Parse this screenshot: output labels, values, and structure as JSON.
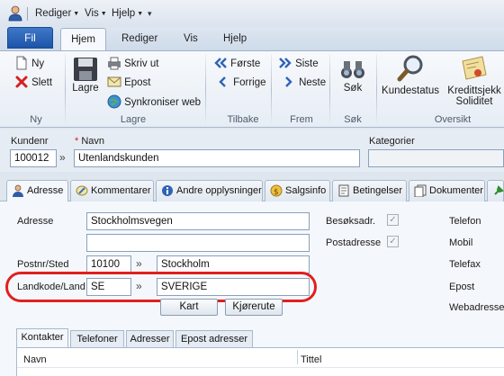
{
  "qab": {
    "menu1": "Rediger",
    "menu2": "Vis",
    "menu3": "Hjelp"
  },
  "tabs": {
    "file": "Fil",
    "home": "Hjem",
    "edit": "Rediger",
    "view": "Vis",
    "help": "Hjelp"
  },
  "ribbon": {
    "groups": {
      "ny": "Ny",
      "lagre": "Lagre",
      "tilbake": "Tilbake",
      "frem": "Frem",
      "sok": "Søk",
      "oversikt": "Oversikt"
    },
    "ny_label": "Ny",
    "slett_label": "Slett",
    "lagre_label": "Lagre",
    "skriv_ut_label": "Skriv ut",
    "epost_label": "Epost",
    "synk_label": "Synkroniser web",
    "forste_label": "Første",
    "forrige_label": "Forrige",
    "siste_label": "Siste",
    "neste_label": "Neste",
    "sok_label": "Søk",
    "kundestatus_label": "Kundestatus",
    "kredittsjekk_label1": "Kredittsjekk",
    "kredittsjekk_label2": "Soliditet"
  },
  "customer": {
    "kundenr_label": "Kundenr",
    "kundenr_value": "100012",
    "navn_required": "*",
    "navn_label": "Navn",
    "navn_value": "Utenlandskunden",
    "kategorier_label": "Kategorier"
  },
  "inner_tabs": {
    "adresse": "Adresse",
    "kommentarer": "Kommentarer",
    "andre": "Andre opplysninger",
    "salgsinfo": "Salgsinfo",
    "betingelser": "Betingelser",
    "dokumenter": "Dokumenter"
  },
  "form": {
    "adresse_label": "Adresse",
    "adresse1_value": "Stockholmsvegen",
    "adresse2_value": "",
    "postnr_label": "Postnr/Sted",
    "postnr_value": "10100",
    "sted_value": "Stockholm",
    "landkode_label": "Landkode/Land",
    "landkode_value": "SE",
    "land_value": "SVERIGE",
    "kart_button": "Kart",
    "kjorerute_button": "Kjørerute",
    "besok_label": "Besøksadr.",
    "post_label": "Postadresse",
    "check_mark": "✓",
    "telefon_label": "Telefon",
    "mobil_label": "Mobil",
    "telefax_label": "Telefax",
    "epost_label": "Epost",
    "webadresse_label": "Webadresse"
  },
  "bottom_tabs": {
    "kontakter": "Kontakter",
    "telefoner": "Telefoner",
    "adresser": "Adresser",
    "epost": "Epost adresser"
  },
  "grid": {
    "col_navn": "Navn",
    "col_tittel": "Tittel"
  },
  "colors": {
    "highlight": "#e02020",
    "file_tab": "#2a62b6"
  }
}
